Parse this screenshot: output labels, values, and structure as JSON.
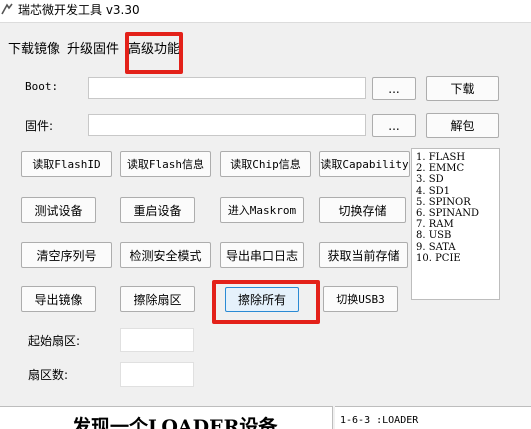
{
  "window": {
    "title": "瑞芯微开发工具 v3.30"
  },
  "tabs": [
    {
      "label": "下载镜像"
    },
    {
      "label": "升级固件"
    },
    {
      "label": "高级功能"
    }
  ],
  "boot": {
    "label": "Boot:",
    "value": "",
    "browse_label": "...",
    "action_label": "下载"
  },
  "firmware": {
    "label": "固件:",
    "value": "",
    "browse_label": "...",
    "action_label": "解包"
  },
  "buttons": {
    "read_flash_id": "读取FlashID",
    "read_flash_info": "读取Flash信息",
    "read_chip_info": "读取Chip信息",
    "read_capability": "读取Capability",
    "test_device": "测试设备",
    "reset_device": "重启设备",
    "enter_maskrom": "进入Maskrom",
    "switch_storage": "切换存储",
    "clear_serial": "清空序列号",
    "check_secure_mode": "检测安全模式",
    "export_serial_log": "导出串口日志",
    "get_current_storage": "获取当前存储",
    "export_image": "导出镜像",
    "erase_sector": "擦除扇区",
    "erase_all": "擦除所有",
    "switch_usb3": "切换USB3"
  },
  "storage_list": [
    "1.  FLASH",
    "2.  EMMC",
    "3.  SD",
    "4.  SD1",
    "5.  SPINOR",
    "6.  SPINAND",
    "7.  RAM",
    "8.  USB",
    "9.  SATA",
    "10.  PCIE"
  ],
  "start_sector": {
    "label": "起始扇区:",
    "value": ""
  },
  "sector_count": {
    "label": "扇区数:",
    "value": ""
  },
  "status": {
    "message": "发现一个LOADER设备"
  },
  "log": {
    "line": "1-6-3 :LOADER"
  },
  "colors": {
    "highlight": "#e32119",
    "focus_border": "#2a8ad4"
  }
}
